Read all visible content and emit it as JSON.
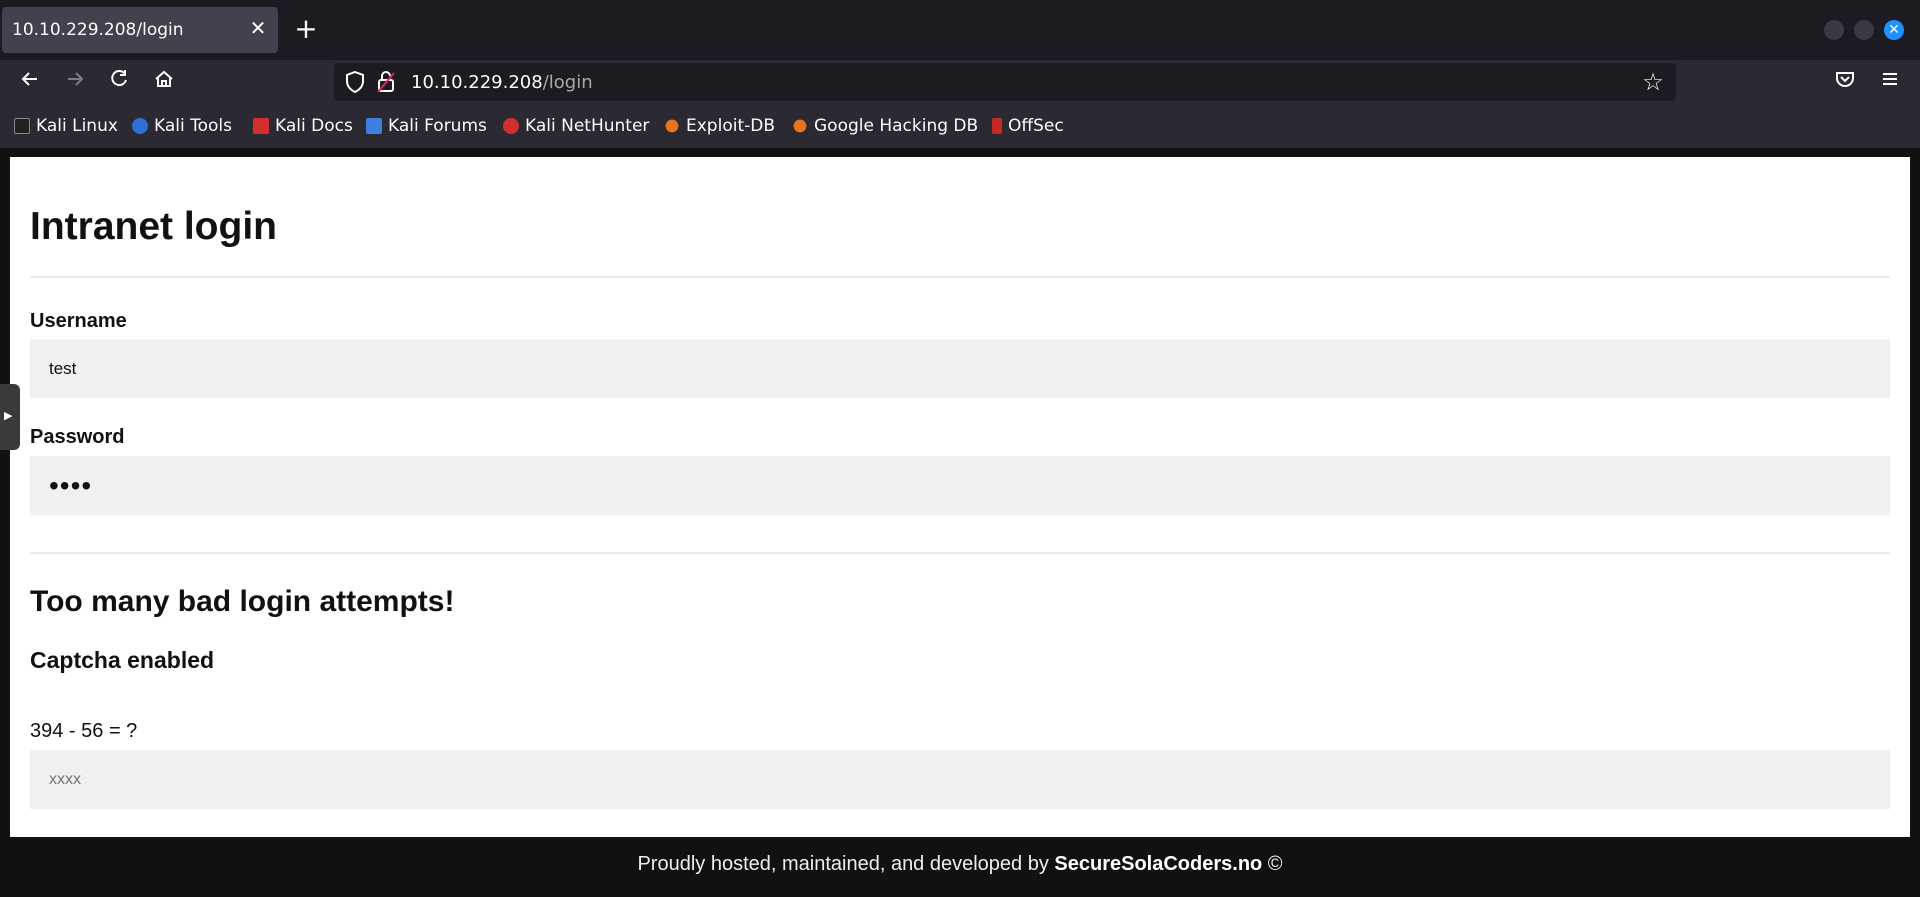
{
  "browser": {
    "tab_title": "10.10.229.208/login",
    "tab_close": "✕",
    "new_tab": "+",
    "url_host": "10.10.229.208",
    "url_path": "/login",
    "bookmarks": [
      {
        "label": "Kali Linux",
        "color": "#222222"
      },
      {
        "label": "Kali Tools",
        "color": "#2f6fd6"
      },
      {
        "label": "Kali Docs",
        "color": "#d32f2f"
      },
      {
        "label": "Kali Forums",
        "color": "#3f7fe0"
      },
      {
        "label": "Kali NetHunter",
        "color": "#d32f2f"
      },
      {
        "label": "Exploit-DB",
        "color": "#e8731c"
      },
      {
        "label": "Google Hacking DB",
        "color": "#e8731c"
      },
      {
        "label": "OffSec",
        "color": "#c62828"
      }
    ]
  },
  "page": {
    "title": "Intranet login",
    "username_label": "Username",
    "username_value": "test",
    "password_label": "Password",
    "password_value": "••••",
    "warning": "Too many bad login attempts!",
    "captcha_heading": "Captcha enabled",
    "captcha_question": "394 - 56 = ?",
    "captcha_placeholder": "xxxx",
    "footer_prefix": "Proudly hosted, maintained, and developed by ",
    "footer_brand": "SecureSolaCoders.no",
    "footer_suffix": " ©"
  },
  "colors": {
    "chrome_dark": "#1c1b22",
    "chrome": "#2b2a33",
    "accent": "#1e90ff"
  }
}
